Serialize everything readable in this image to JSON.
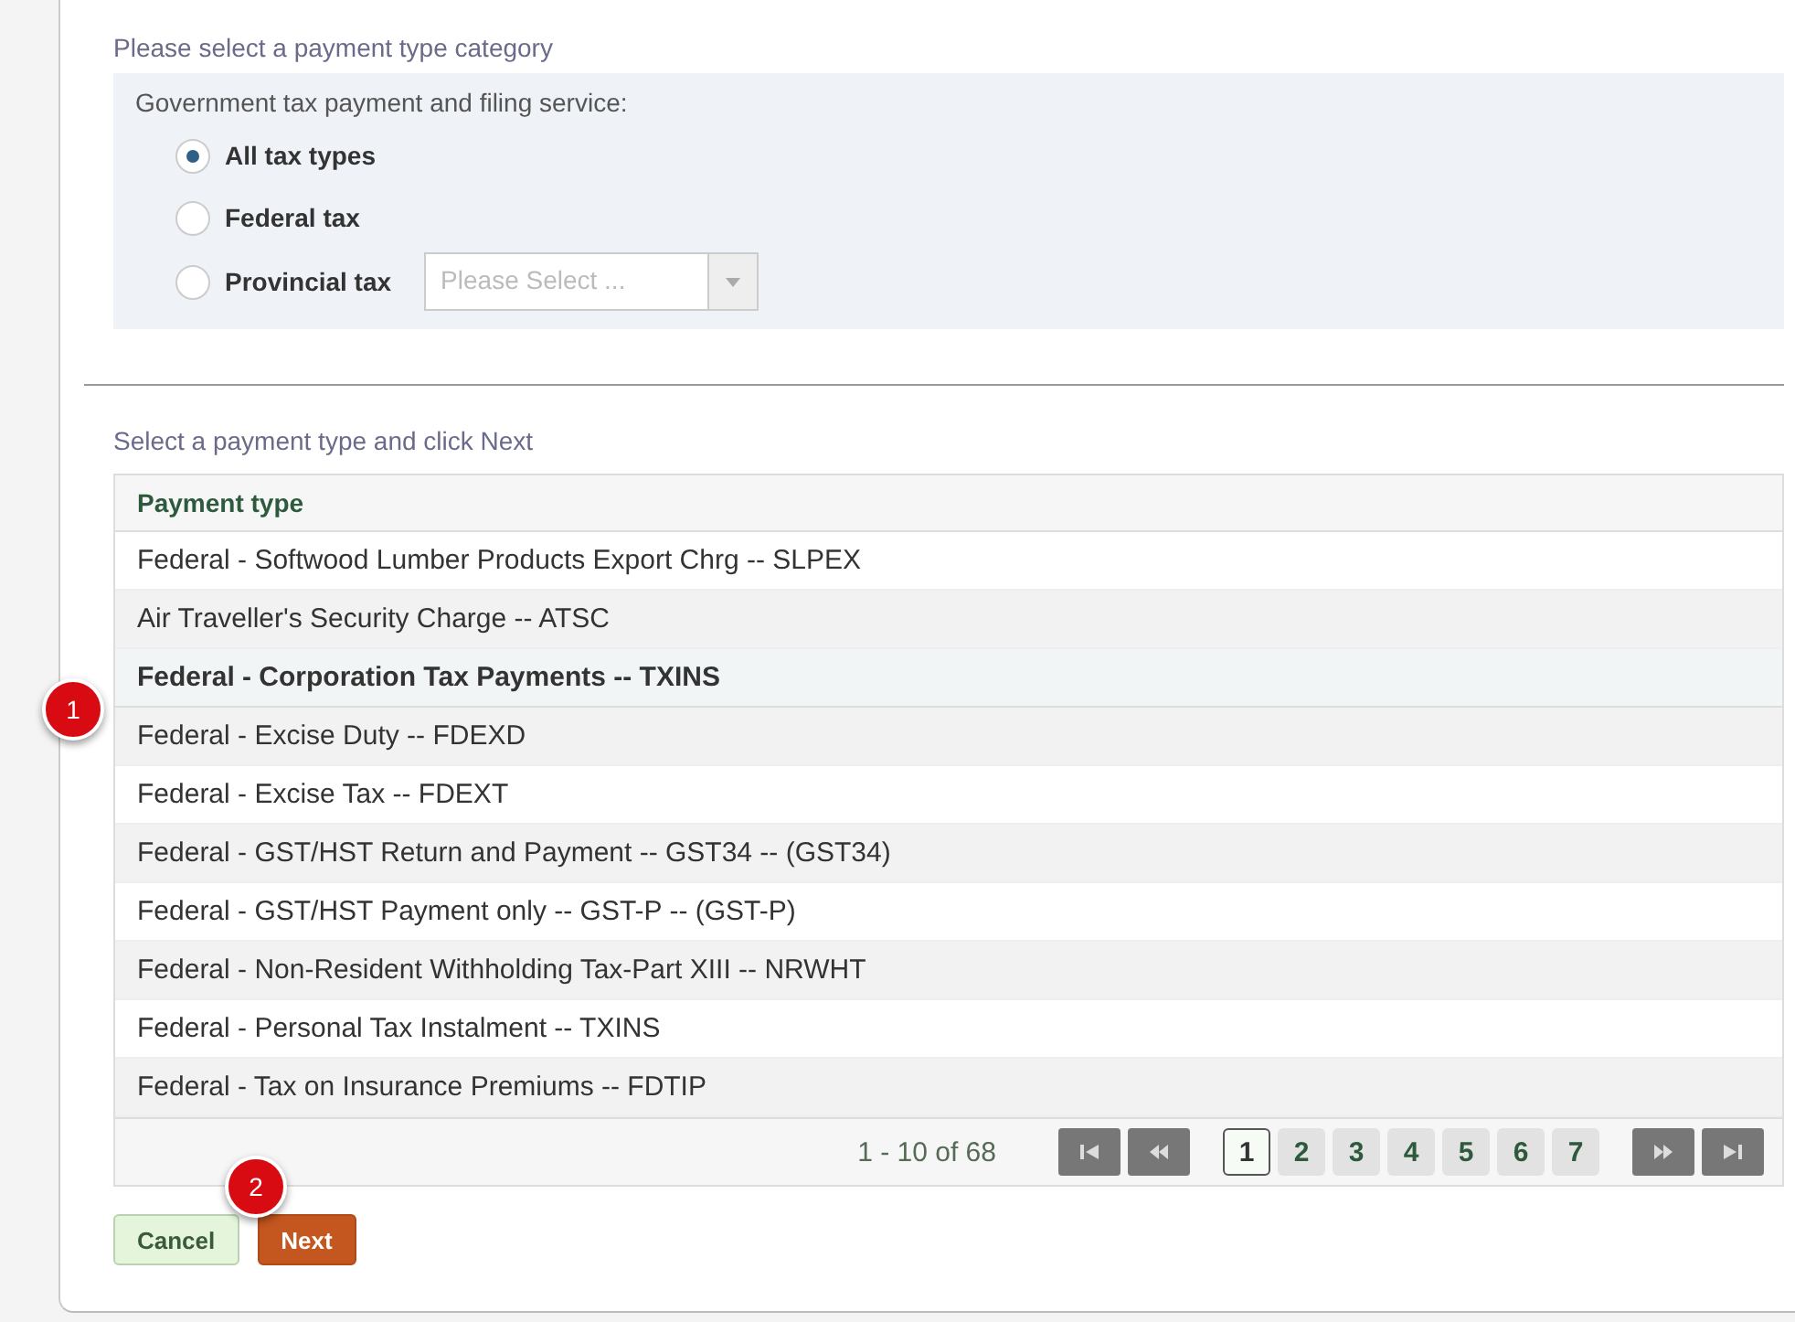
{
  "category": {
    "heading": "Please select a payment type category",
    "panel_label": "Government tax payment and filing service:",
    "options": [
      {
        "label": "All tax types",
        "selected": true
      },
      {
        "label": "Federal tax",
        "selected": false
      },
      {
        "label": "Provincial tax",
        "selected": false,
        "dropdown_placeholder": "Please Select ..."
      }
    ]
  },
  "instruction": "Select a payment type and click Next",
  "table": {
    "columns": [
      "Payment type"
    ],
    "rows": [
      {
        "cell": "Federal - Softwood Lumber Products Export Chrg -- SLPEX",
        "selected": false
      },
      {
        "cell": "Air Traveller's Security Charge -- ATSC",
        "selected": false
      },
      {
        "cell": "Federal - Corporation Tax Payments -- TXINS",
        "selected": true
      },
      {
        "cell": "Federal - Excise Duty -- FDEXD",
        "selected": false
      },
      {
        "cell": "Federal - Excise Tax -- FDEXT",
        "selected": false
      },
      {
        "cell": "Federal - GST/HST  Return and Payment -- GST34 -- (GST34)",
        "selected": false
      },
      {
        "cell": "Federal - GST/HST Payment only -- GST-P -- (GST-P)",
        "selected": false
      },
      {
        "cell": "Federal - Non-Resident Withholding Tax-Part XIII -- NRWHT",
        "selected": false
      },
      {
        "cell": "Federal - Personal Tax Instalment -- TXINS",
        "selected": false
      },
      {
        "cell": "Federal - Tax on Insurance Premiums -- FDTIP",
        "selected": false
      }
    ]
  },
  "pagination": {
    "range": "1 - 10 of 68",
    "pages": [
      {
        "label": "1",
        "selected": true
      },
      {
        "label": "2",
        "selected": false
      },
      {
        "label": "3",
        "selected": false
      },
      {
        "label": "4",
        "selected": false
      },
      {
        "label": "5",
        "selected": false
      },
      {
        "label": "6",
        "selected": false
      },
      {
        "label": "7",
        "selected": false
      }
    ]
  },
  "buttons": [
    {
      "label": "Cancel",
      "kind": "secondary"
    },
    {
      "label": "Next",
      "kind": "primary"
    }
  ],
  "markers": [
    "1",
    "2"
  ]
}
